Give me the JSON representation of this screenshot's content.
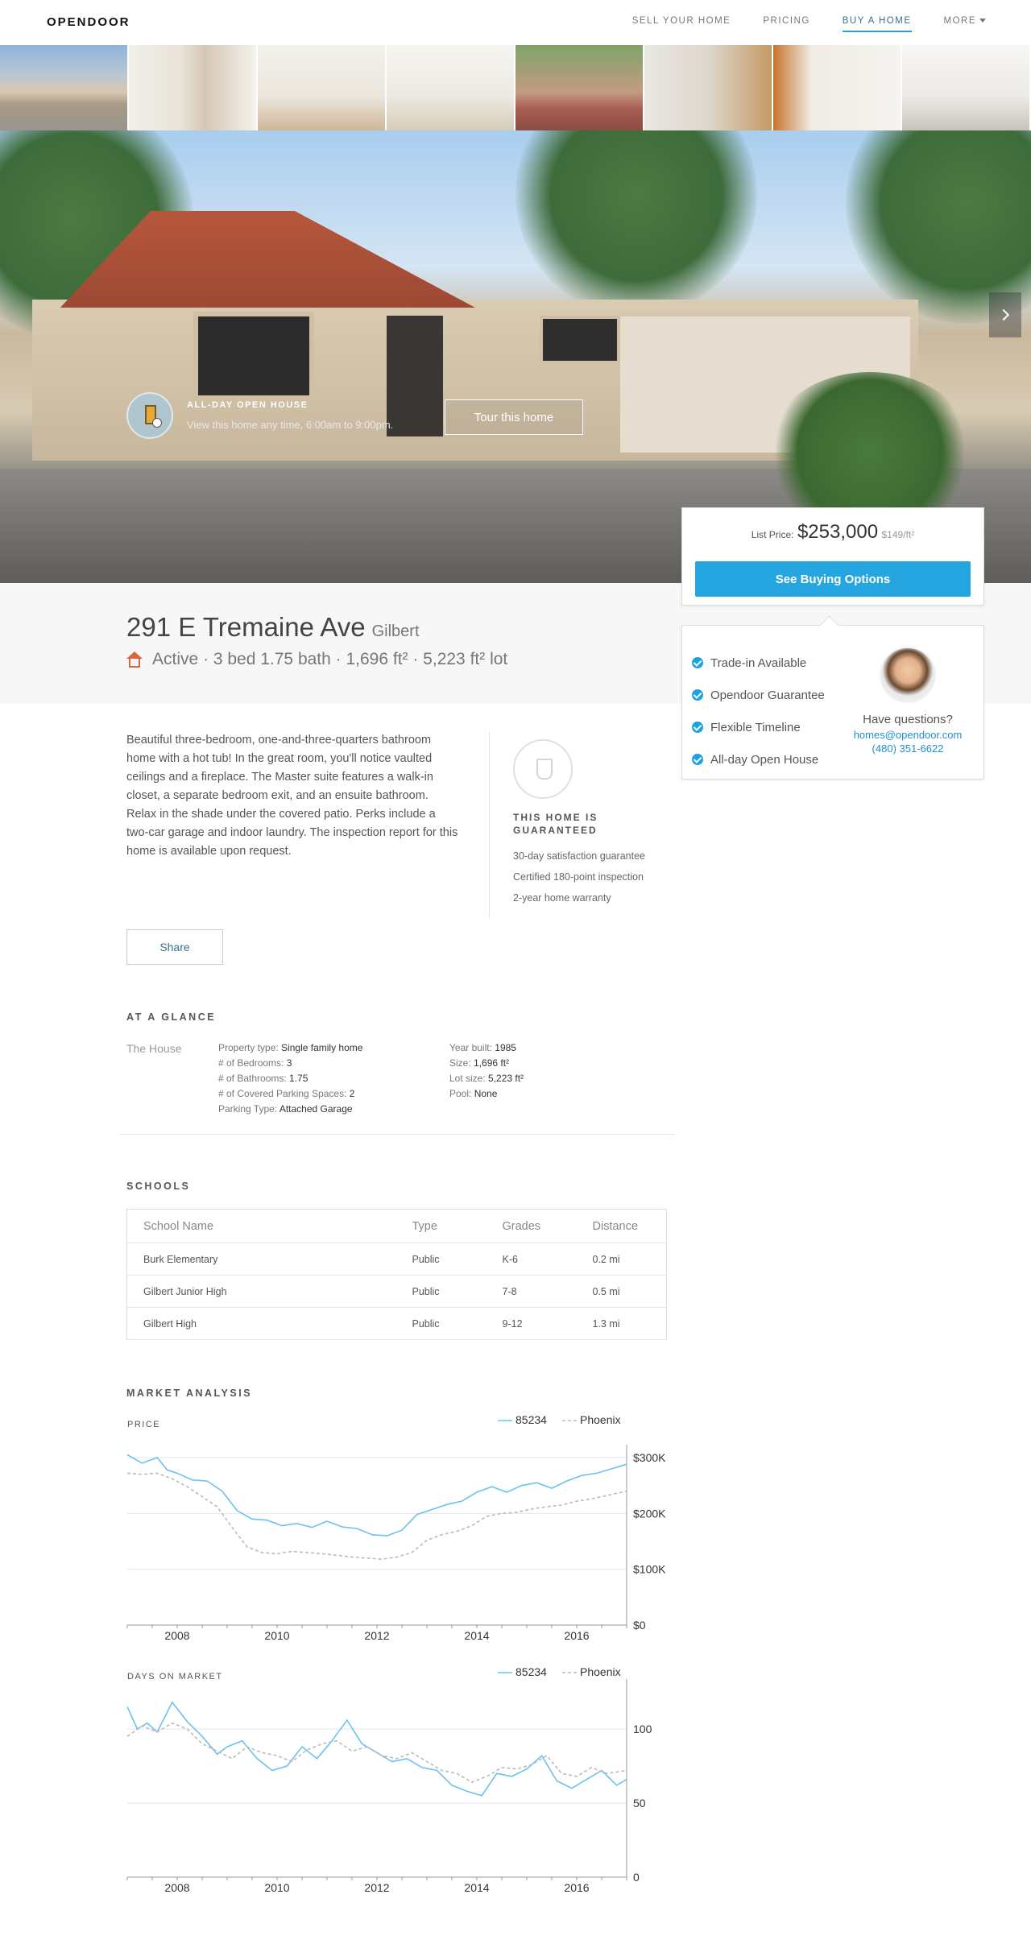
{
  "nav": {
    "logo": "OPENDOOR",
    "links": [
      "SELL YOUR HOME",
      "PRICING",
      "BUY A HOME",
      "MORE"
    ]
  },
  "open_house": {
    "title": "ALL-DAY OPEN HOUSE",
    "subtitle": "View this home any time, 6:00am to 9:00pm.",
    "tour_button": "Tour this home"
  },
  "price_card": {
    "label": "List Price:",
    "price": "$253,000",
    "per_sqft": "$149/ft²",
    "button": "See Buying Options"
  },
  "features": {
    "items": [
      "Trade-in Available",
      "Opendoor Guarantee",
      "Flexible Timeline",
      "All-day Open House"
    ],
    "question": "Have questions?",
    "email": "homes@opendoor.com",
    "phone": "(480) 351-6622"
  },
  "listing": {
    "address": "291 E Tremaine Ave",
    "city": "Gilbert",
    "status": "Active · 3 bed 1.75 bath · 1,696 ft² · 5,223 ft² lot",
    "description": "Beautiful three-bedroom, one-and-three-quarters bathroom home with a hot tub! In the great room, you'll notice vaulted ceilings and a fireplace. The Master suite features a walk-in closet, a separate bedroom exit, and an ensuite bathroom. Relax in the shade under the covered patio. Perks include a two-car garage and indoor laundry. The inspection report for this home is available upon request."
  },
  "guarantee": {
    "title": "THIS HOME IS GUARANTEED",
    "items": [
      "30-day satisfaction guarantee",
      "Certified 180-point inspection",
      "2-year home warranty"
    ],
    "share": "Share"
  },
  "glance": {
    "title": "AT A GLANCE",
    "house_label": "The House",
    "left": [
      {
        "k": "Property type: ",
        "v": "Single family home"
      },
      {
        "k": "# of Bedrooms: ",
        "v": "3"
      },
      {
        "k": "# of Bathrooms: ",
        "v": "1.75"
      },
      {
        "k": "# of Covered Parking Spaces: ",
        "v": "2"
      },
      {
        "k": "Parking Type: ",
        "v": "Attached Garage"
      }
    ],
    "right": [
      {
        "k": "Year built: ",
        "v": "1985"
      },
      {
        "k": "Size: ",
        "v": "1,696 ft²"
      },
      {
        "k": "Lot size: ",
        "v": "5,223 ft²"
      },
      {
        "k": "Pool: ",
        "v": "None"
      }
    ]
  },
  "schools": {
    "title": "SCHOOLS",
    "headers": [
      "School Name",
      "Type",
      "Grades",
      "Distance"
    ],
    "rows": [
      [
        "Burk Elementary",
        "Public",
        "K-6",
        "0.2 mi"
      ],
      [
        "Gilbert Junior High",
        "Public",
        "7-8",
        "0.5 mi"
      ],
      [
        "Gilbert High",
        "Public",
        "9-12",
        "1.3 mi"
      ]
    ]
  },
  "market": {
    "title": "MARKET ANALYSIS"
  },
  "colors": {
    "accent": "#26a6e0",
    "series_85234": "#6cc2ef",
    "series_phoenix": "#bbbbbb"
  },
  "chart_data": [
    {
      "type": "line",
      "title": "PRICE",
      "xlabel": "",
      "ylabel": "",
      "x_ticks": [
        "2008",
        "2010",
        "2012",
        "2014",
        "2016"
      ],
      "y_ticks": [
        "$0",
        "$100K",
        "$200K",
        "$300K"
      ],
      "xlim": [
        2007,
        2017
      ],
      "ylim": [
        0,
        300000
      ],
      "legend": "top-right",
      "grid": true,
      "series": [
        {
          "name": "85234",
          "color": "#6cc2ef",
          "x": [
            2007.0,
            2007.3,
            2007.6,
            2007.8,
            2008.0,
            2008.3,
            2008.6,
            2008.9,
            2009.2,
            2009.5,
            2009.8,
            2010.1,
            2010.4,
            2010.7,
            2011.0,
            2011.3,
            2011.6,
            2011.9,
            2012.2,
            2012.5,
            2012.8,
            2013.1,
            2013.4,
            2013.7,
            2014.0,
            2014.3,
            2014.6,
            2014.9,
            2015.2,
            2015.5,
            2015.8,
            2016.1,
            2016.4,
            2016.7,
            2017.0
          ],
          "values": [
            305000,
            290000,
            300000,
            278000,
            272000,
            260000,
            258000,
            240000,
            205000,
            190000,
            188000,
            178000,
            182000,
            175000,
            186000,
            176000,
            173000,
            162000,
            160000,
            170000,
            198000,
            207000,
            216000,
            222000,
            238000,
            248000,
            238000,
            250000,
            255000,
            245000,
            258000,
            268000,
            272000,
            280000,
            288000
          ]
        },
        {
          "name": "Phoenix",
          "color": "#bbbbbb",
          "x": [
            2007.0,
            2007.3,
            2007.6,
            2007.9,
            2008.2,
            2008.5,
            2008.8,
            2009.1,
            2009.4,
            2009.7,
            2010.0,
            2010.3,
            2010.6,
            2010.9,
            2011.2,
            2011.5,
            2011.8,
            2012.1,
            2012.4,
            2012.7,
            2013.0,
            2013.3,
            2013.6,
            2013.9,
            2014.2,
            2014.5,
            2014.8,
            2015.1,
            2015.4,
            2015.7,
            2016.0,
            2016.3,
            2016.6,
            2017.0
          ],
          "values": [
            272000,
            270000,
            272000,
            262000,
            248000,
            230000,
            212000,
            175000,
            140000,
            130000,
            128000,
            132000,
            130000,
            128000,
            125000,
            122000,
            120000,
            118000,
            122000,
            130000,
            152000,
            162000,
            168000,
            178000,
            195000,
            200000,
            202000,
            208000,
            212000,
            215000,
            222000,
            226000,
            232000,
            240000
          ]
        }
      ]
    },
    {
      "type": "line",
      "title": "DAYS ON MARKET",
      "xlabel": "",
      "ylabel": "",
      "x_ticks": [
        "2008",
        "2010",
        "2012",
        "2014",
        "2016"
      ],
      "y_ticks": [
        "0",
        "50",
        "100"
      ],
      "xlim": [
        2007,
        2017
      ],
      "ylim": [
        0,
        125
      ],
      "legend": "top-right",
      "grid": true,
      "series": [
        {
          "name": "85234",
          "color": "#6cc2ef",
          "x": [
            2007.0,
            2007.2,
            2007.4,
            2007.6,
            2007.9,
            2008.2,
            2008.5,
            2008.8,
            2009.0,
            2009.3,
            2009.6,
            2009.9,
            2010.2,
            2010.5,
            2010.8,
            2011.1,
            2011.4,
            2011.7,
            2012.0,
            2012.3,
            2012.6,
            2012.9,
            2013.2,
            2013.5,
            2013.8,
            2014.1,
            2014.4,
            2014.7,
            2015.0,
            2015.3,
            2015.6,
            2015.9,
            2016.2,
            2016.5,
            2016.8,
            2017.0
          ],
          "values": [
            115,
            100,
            104,
            98,
            118,
            105,
            95,
            83,
            88,
            92,
            80,
            72,
            75,
            88,
            80,
            92,
            106,
            90,
            84,
            78,
            80,
            74,
            72,
            62,
            58,
            55,
            70,
            68,
            73,
            82,
            65,
            60,
            66,
            72,
            62,
            66
          ]
        },
        {
          "name": "Phoenix",
          "color": "#bbbbbb",
          "x": [
            2007.0,
            2007.3,
            2007.6,
            2007.9,
            2008.2,
            2008.5,
            2008.8,
            2009.1,
            2009.4,
            2009.7,
            2010.0,
            2010.3,
            2010.6,
            2010.9,
            2011.2,
            2011.5,
            2011.8,
            2012.1,
            2012.4,
            2012.7,
            2013.0,
            2013.3,
            2013.6,
            2013.9,
            2014.2,
            2014.5,
            2014.8,
            2015.1,
            2015.4,
            2015.7,
            2016.0,
            2016.3,
            2016.6,
            2017.0
          ],
          "values": [
            95,
            102,
            98,
            104,
            100,
            90,
            85,
            80,
            88,
            84,
            82,
            78,
            86,
            90,
            92,
            85,
            88,
            82,
            80,
            84,
            78,
            72,
            70,
            64,
            68,
            74,
            73,
            76,
            82,
            70,
            68,
            74,
            70,
            72
          ]
        }
      ]
    }
  ]
}
